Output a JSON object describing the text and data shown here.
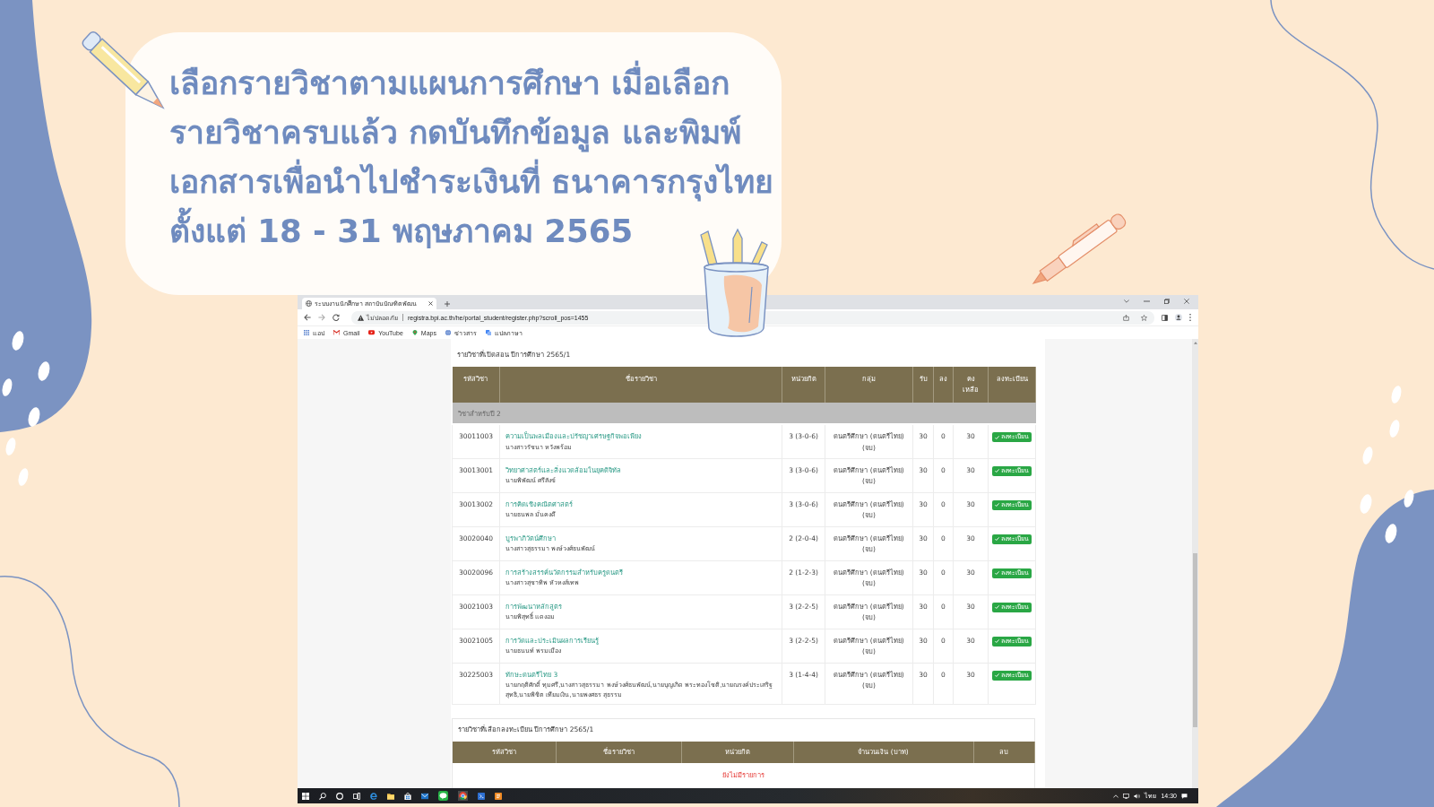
{
  "caption": {
    "lines": [
      "เลือกรายวิชาตามแผนการศึกษา เมื่อเลือก",
      "รายวิชาครบแล้ว กดบันทึกข้อมูล และพิมพ์",
      "เอกสารเพื่อนำไปชำระเงินที่ ธนาคารกรุงไทย",
      "ตั้งแต่ 18 - 31 พฤษภาคม 2565"
    ]
  },
  "browser": {
    "tabs": [
      {
        "title": "ระบบงานนักศึกษา สถาบันบัณฑิตพัฒน",
        "selected": true
      }
    ],
    "address_bar": {
      "security_label": "ไม่ปลอดภัย",
      "url": "registra.bpi.ac.th/he/portal_student/register.php?scroll_pos=1455"
    },
    "bookmarks": [
      {
        "label": "แอป"
      },
      {
        "label": "Gmail"
      },
      {
        "label": "YouTube"
      },
      {
        "label": "Maps"
      },
      {
        "label": "ข่าวสาร"
      },
      {
        "label": "แปลภาษา"
      }
    ]
  },
  "open_courses": {
    "heading": "รายวิชาที่เปิดสอน ปีการศึกษา 2565/1",
    "columns": [
      "รหัสวิชา",
      "ชื่อรายวิชา",
      "หน่วยกิต",
      "กลุ่ม",
      "รับ",
      "ลง",
      "คงเหลือ",
      "ลงทะเบียน"
    ],
    "group_label": "วิชาสำหรับปี 2",
    "rows": [
      {
        "code": "30011003",
        "name": "ความเป็นพลเมืองและปรัชญาเศรษฐกิจพอเพียง",
        "instructor": "นางสาวรัชนา หวังพร้อม",
        "credits": "3 (3-0-6)",
        "group": "ดนตรีศึกษา (ดนตรีไทย) (จบ)",
        "accepted": "30",
        "enrolled": "0",
        "remaining": "30",
        "action": "ลงทะเบียน"
      },
      {
        "code": "30013001",
        "name": "วิทยาศาสตร์และสิ่งแวดล้อมในยุคดิจิทัล",
        "instructor": "นายพิพัฒน์ ศรีสังข์",
        "credits": "3 (3-0-6)",
        "group": "ดนตรีศึกษา (ดนตรีไทย) (จบ)",
        "accepted": "30",
        "enrolled": "0",
        "remaining": "30",
        "action": "ลงทะเบียน"
      },
      {
        "code": "30013002",
        "name": "การคิดเชิงคณิตศาสตร์",
        "instructor": "นายธนพล มั่นคงดี",
        "credits": "3 (3-0-6)",
        "group": "ดนตรีศึกษา (ดนตรีไทย) (จบ)",
        "accepted": "30",
        "enrolled": "0",
        "remaining": "30",
        "action": "ลงทะเบียน"
      },
      {
        "code": "30020040",
        "name": "บูรพาภิวัตน์ศึกษา",
        "instructor": "นางสาวสุธรรมา พงษ์วงศ์ธนพัฒน์",
        "credits": "2 (2-0-4)",
        "group": "ดนตรีศึกษา (ดนตรีไทย) (จบ)",
        "accepted": "30",
        "enrolled": "0",
        "remaining": "30",
        "action": "ลงทะเบียน"
      },
      {
        "code": "30020096",
        "name": "การสร้างสรรค์นวัตกรรมสำหรับครูดนตรี",
        "instructor": "นางสาวสุชาทิพ หัวหงส์เทพ",
        "credits": "2 (1-2-3)",
        "group": "ดนตรีศึกษา (ดนตรีไทย) (จบ)",
        "accepted": "30",
        "enrolled": "0",
        "remaining": "30",
        "action": "ลงทะเบียน"
      },
      {
        "code": "30021003",
        "name": "การพัฒนาหลักสูตร",
        "instructor": "นายพิสุทธิ์ แดงอม",
        "credits": "3 (2-2-5)",
        "group": "ดนตรีศึกษา (ดนตรีไทย) (จบ)",
        "accepted": "30",
        "enrolled": "0",
        "remaining": "30",
        "action": "ลงทะเบียน"
      },
      {
        "code": "30021005",
        "name": "การวัดและประเมินผลการเรียนรู้",
        "instructor": "นายธนนท์ พรมเมือง",
        "credits": "3 (2-2-5)",
        "group": "ดนตรีศึกษา (ดนตรีไทย) (จบ)",
        "accepted": "30",
        "enrolled": "0",
        "remaining": "30",
        "action": "ลงทะเบียน"
      },
      {
        "code": "30225003",
        "name": "ทักษะดนตรีไทย 3",
        "instructor": "นายกฤติศักดิ์ ทุมศรี,นางสาวสุธรรมา พงษ์วงศ์ธนพัฒน์,นายบุญเกิด พระทองโชติ,นายณรงค์ประเสริฐ สุทธิ,นายพิชิต เทียมเงิน,นายพงศธร สุธรรม",
        "credits": "3 (1-4-4)",
        "group": "ดนตรีศึกษา (ดนตรีไทย) (จบ)",
        "accepted": "30",
        "enrolled": "0",
        "remaining": "30",
        "action": "ลงทะเบียน"
      }
    ]
  },
  "selected_courses": {
    "heading": "รายวิชาที่เลือกลงทะเบียน ปีการศึกษา 2565/1",
    "columns": [
      "รหัสวิชา",
      "ชื่อรายวิชา",
      "หน่วยกิต",
      "จำนวนเงิน (บาท)",
      "ลบ"
    ],
    "empty_message": "ยังไม่มีรายการ"
  },
  "taskbar": {
    "language": "ไทย",
    "time": "14:30"
  }
}
